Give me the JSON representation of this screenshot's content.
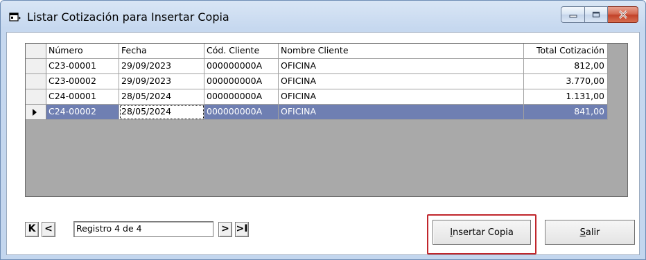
{
  "window": {
    "title": "Listar Cotización para Insertar Copia",
    "icon": "app-window-icon"
  },
  "caption_buttons": [
    "minimize-icon",
    "maximize-icon",
    "close-icon"
  ],
  "grid": {
    "columns": [
      "Número",
      "Fecha",
      "Cód. Cliente",
      "Nombre Cliente",
      "Total Cotización"
    ],
    "rows": [
      {
        "numero": "C23-00001",
        "fecha": "29/09/2023",
        "cod": "000000000A",
        "nombre": "OFICINA",
        "total": "812,00"
      },
      {
        "numero": "C23-00002",
        "fecha": "29/09/2023",
        "cod": "000000000A",
        "nombre": "OFICINA",
        "total": "3.770,00"
      },
      {
        "numero": "C24-00001",
        "fecha": "28/05/2024",
        "cod": "000000000A",
        "nombre": "OFICINA",
        "total": "1.131,00"
      },
      {
        "numero": "C24-00002",
        "fecha": "28/05/2024",
        "cod": "000000000A",
        "nombre": "OFICINA",
        "total": "841,00"
      }
    ],
    "selected_row_index": 3
  },
  "navigator": {
    "first": "K",
    "prev": "<",
    "record_text": "Registro 4 de 4",
    "next": ">",
    "last": ">I"
  },
  "buttons": {
    "insert_copy_accel": "I",
    "insert_copy_rest": "nsertar Copia",
    "exit_accel": "S",
    "exit_rest": "alir"
  },
  "colors": {
    "selected_row": "#6f7fb2",
    "highlight": "#c0262c"
  }
}
